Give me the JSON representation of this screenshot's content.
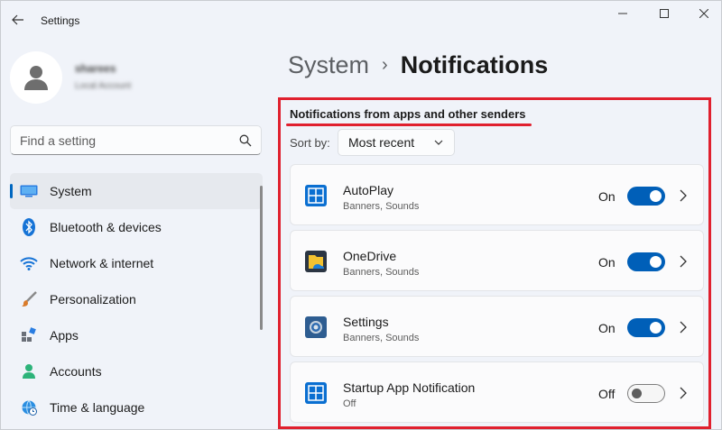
{
  "window": {
    "title": "Settings"
  },
  "profile": {
    "name": "sharees",
    "account": "Local Account"
  },
  "search": {
    "placeholder": "Find a setting"
  },
  "sidebar": {
    "items": [
      {
        "label": "System",
        "icon": "system-icon",
        "selected": true
      },
      {
        "label": "Bluetooth & devices",
        "icon": "bluetooth-icon"
      },
      {
        "label": "Network & internet",
        "icon": "wifi-icon"
      },
      {
        "label": "Personalization",
        "icon": "brush-icon"
      },
      {
        "label": "Apps",
        "icon": "apps-icon"
      },
      {
        "label": "Accounts",
        "icon": "accounts-icon"
      },
      {
        "label": "Time & language",
        "icon": "globe-clock-icon"
      }
    ]
  },
  "breadcrumb": {
    "parent": "System",
    "separator": "›",
    "current": "Notifications"
  },
  "section": {
    "title": "Notifications from apps and other senders"
  },
  "sort": {
    "label": "Sort by:",
    "value": "Most recent"
  },
  "apps": [
    {
      "name": "AutoPlay",
      "sub": "Banners, Sounds",
      "state": "On",
      "on": true,
      "icon": "autoplay-icon"
    },
    {
      "name": "OneDrive",
      "sub": "Banners, Sounds",
      "state": "On",
      "on": true,
      "icon": "onedrive-icon"
    },
    {
      "name": "Settings",
      "sub": "Banners, Sounds",
      "state": "On",
      "on": true,
      "icon": "settings-gear-icon"
    },
    {
      "name": "Startup App Notification",
      "sub": "Off",
      "state": "Off",
      "on": false,
      "icon": "startup-app-icon"
    }
  ],
  "colors": {
    "accent": "#005fb8",
    "highlight": "#e0202e"
  }
}
